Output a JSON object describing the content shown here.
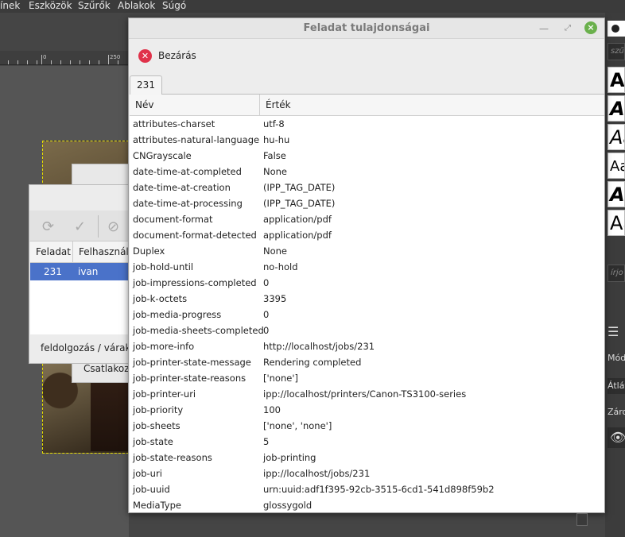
{
  "app_menu": [
    "ínek",
    "Eszközök",
    "Szűrők",
    "Ablakok",
    "Súgó"
  ],
  "ruler": {
    "labels": [
      "0",
      "250"
    ]
  },
  "right_dock": {
    "search_placeholder": "szűr",
    "font_previews": [
      "Aa",
      "Aa",
      "Aa",
      "Aa",
      "Aa",
      "Aa"
    ],
    "write_placeholder": "írjo",
    "labels": [
      "Mód",
      "Átlát",
      "Zárol"
    ]
  },
  "queue_window": {
    "columns": [
      "Feladat",
      "Felhasználó"
    ],
    "selected_row": {
      "job": "231",
      "user": "ivan"
    },
    "status_text": "feldolgozás / várakozás",
    "connect_label": "Csatlakoztatva"
  },
  "dialog": {
    "title": "Feladat tulajdonságai",
    "close_label": "Bezárás",
    "tab_label": "231",
    "columns": {
      "name": "Név",
      "value": "Érték"
    },
    "rows": [
      {
        "k": "attributes-charset",
        "v": "utf-8"
      },
      {
        "k": "attributes-natural-language",
        "v": "hu-hu"
      },
      {
        "k": "CNGrayscale",
        "v": "False"
      },
      {
        "k": "date-time-at-completed",
        "v": "None"
      },
      {
        "k": "date-time-at-creation",
        "v": "(IPP_TAG_DATE)"
      },
      {
        "k": "date-time-at-processing",
        "v": "(IPP_TAG_DATE)"
      },
      {
        "k": "document-format",
        "v": "application/pdf"
      },
      {
        "k": "document-format-detected",
        "v": "application/pdf"
      },
      {
        "k": "Duplex",
        "v": "None"
      },
      {
        "k": "job-hold-until",
        "v": "no-hold"
      },
      {
        "k": "job-impressions-completed",
        "v": "0"
      },
      {
        "k": "job-k-octets",
        "v": "3395"
      },
      {
        "k": "job-media-progress",
        "v": "0"
      },
      {
        "k": "job-media-sheets-completed",
        "v": "0"
      },
      {
        "k": "job-more-info",
        "v": "http://localhost/jobs/231"
      },
      {
        "k": "job-printer-state-message",
        "v": "Rendering completed"
      },
      {
        "k": "job-printer-state-reasons",
        "v": "['none']"
      },
      {
        "k": "job-printer-uri",
        "v": "ipp://localhost/printers/Canon-TS3100-series"
      },
      {
        "k": "job-priority",
        "v": "100"
      },
      {
        "k": "job-sheets",
        "v": "['none', 'none']"
      },
      {
        "k": "job-state",
        "v": "5"
      },
      {
        "k": "job-state-reasons",
        "v": "job-printing"
      },
      {
        "k": "job-uri",
        "v": "ipp://localhost/jobs/231"
      },
      {
        "k": "job-uuid",
        "v": "urn:uuid:adf1f395-92cb-3515-6cd1-541d898f59b2"
      },
      {
        "k": "MediaType",
        "v": "glossygold"
      }
    ]
  }
}
